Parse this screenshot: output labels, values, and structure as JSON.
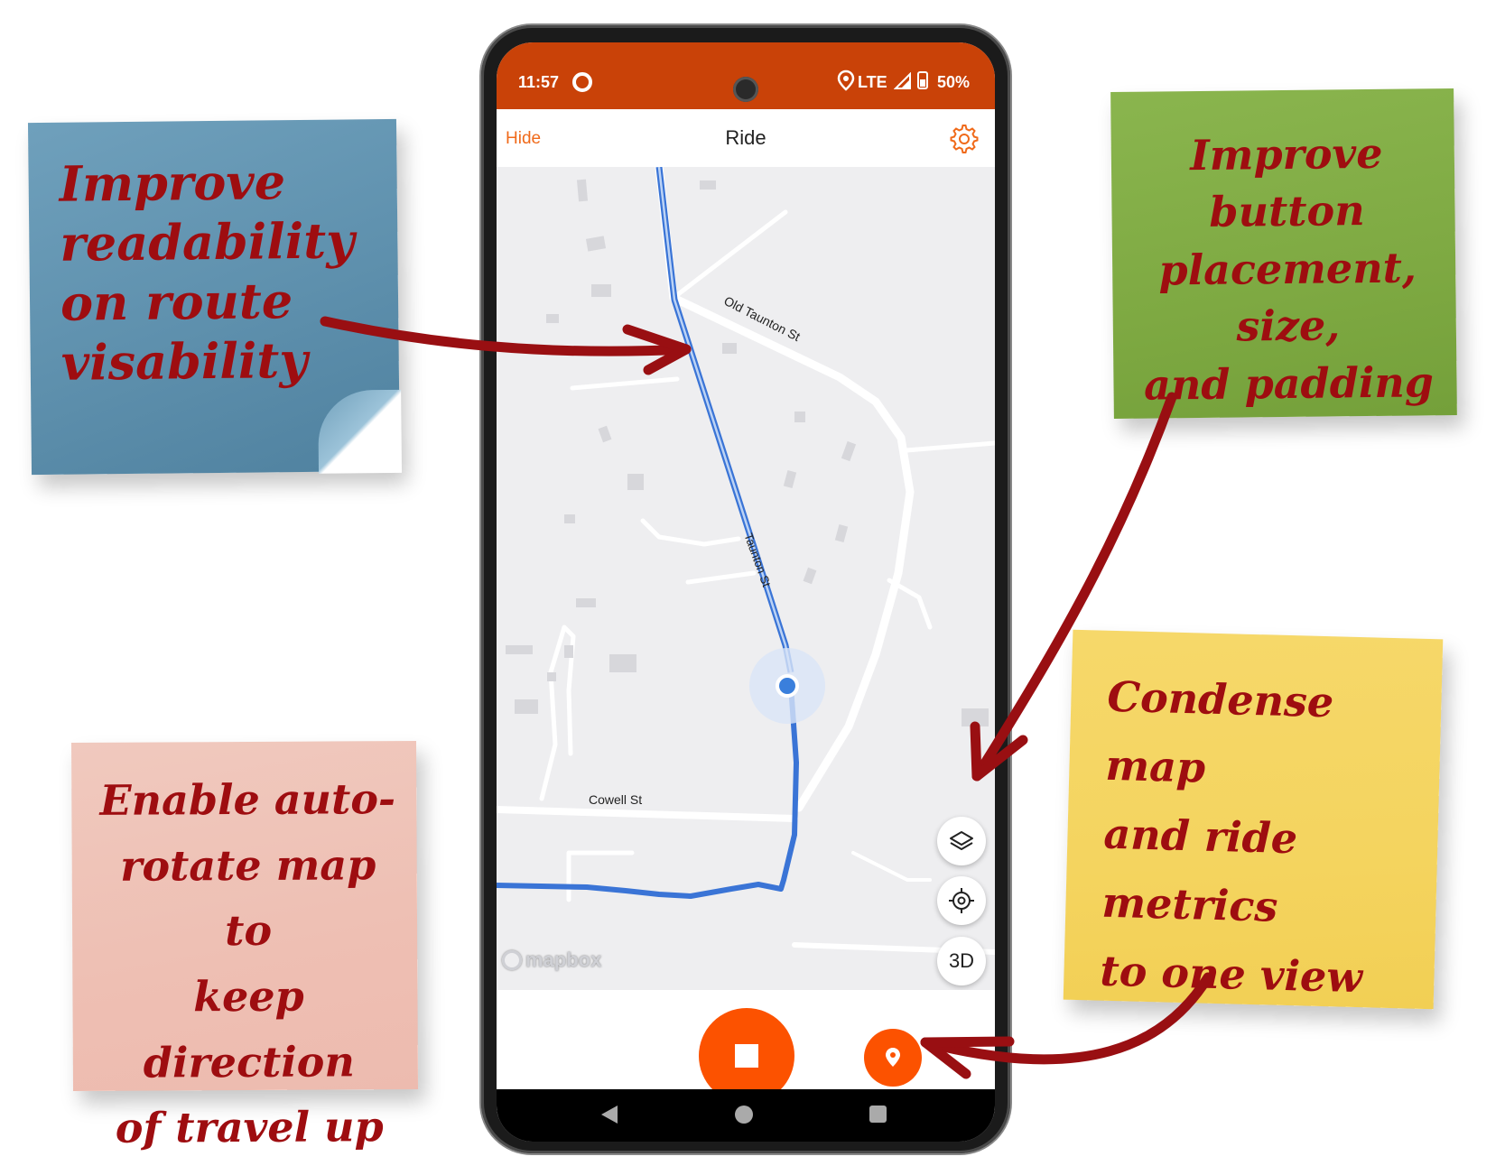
{
  "notes": {
    "blue": "Improve\nreadability\non route\nvisability",
    "green": "Improve button\nplacement, size,\nand padding",
    "yellow": "Condense map\nand ride metrics\nto one view",
    "pink": "Enable auto-\nrotate map to\nkeep direction\nof travel up"
  },
  "status_bar": {
    "time": "11:57",
    "network": "LTE",
    "battery": "50%"
  },
  "app_bar": {
    "hide_label": "Hide",
    "title": "Ride",
    "settings_icon": "gear-icon"
  },
  "map": {
    "road_labels": {
      "old_taunton": "Old Taunton St",
      "taunton": "Taunton St",
      "cowell": "Cowell St"
    },
    "attribution": "mapbox",
    "buttons": {
      "layers_icon": "layers-icon",
      "locate_icon": "crosshair-icon",
      "three_d_label": "3D"
    }
  },
  "controls": {
    "stop_icon": "stop-icon",
    "pin_icon": "location-pin-icon"
  },
  "nav": {
    "back_icon": "back-triangle-icon",
    "home_icon": "home-circle-icon",
    "recents_icon": "recents-square-icon"
  },
  "colors": {
    "accent": "#fc5200",
    "status_bar": "#c94208",
    "route": "#3a74d6",
    "annotation_ink": "#9e0d10"
  }
}
